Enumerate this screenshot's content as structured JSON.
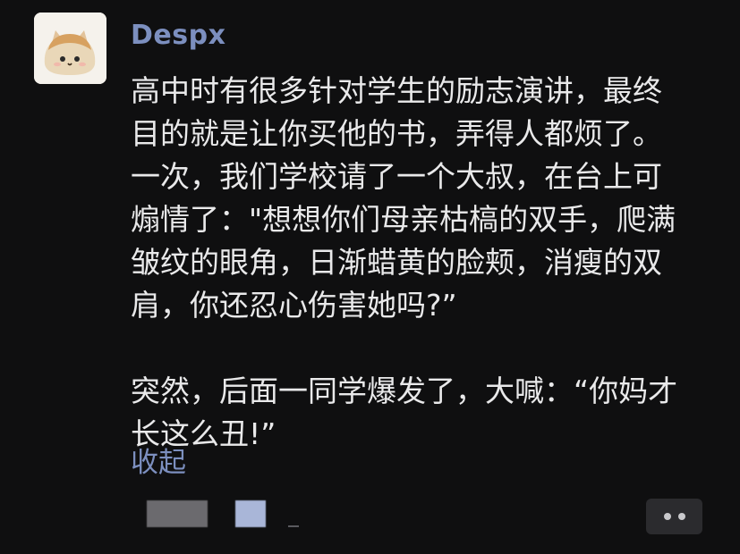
{
  "post": {
    "author": "Despx",
    "paragraphs": [
      {
        "lines": [
          "高中时有很多针对学生的励志演讲，最终",
          "目的就是让你买他的书，弄得人都烦了。",
          "一次，我们学校请了一个大叔，在台上可",
          "煽情了：\"想想你们母亲枯槁的双手，爬满",
          "皱纹的眼角，日渐蜡黄的脸颊，消瘦的双",
          "肩，你还忍心伤害她吗?”"
        ]
      },
      {
        "lines": [
          "突然，后面一同学爆发了，大喊：“你妈才",
          "长这么丑!”"
        ]
      }
    ],
    "collapse_label": "收起"
  },
  "icons": {
    "avatar": "cat-bread-avatar-icon",
    "more": "more-dots-icon"
  },
  "colors": {
    "background": "#0f0f10",
    "text": "#e9e9ea",
    "accent": "#7c8fbf",
    "button_bg": "#2b2b2e"
  }
}
